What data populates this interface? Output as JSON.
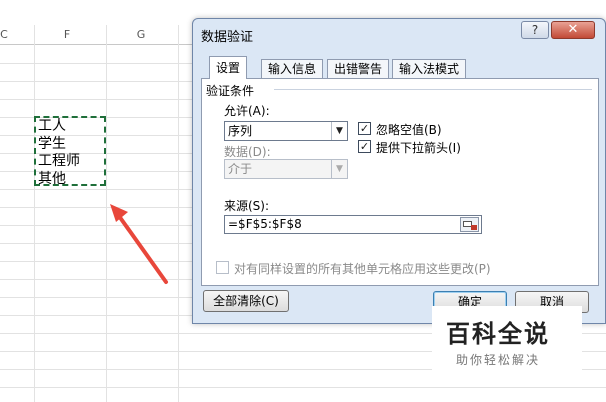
{
  "spreadsheet": {
    "column_headers": [
      "C",
      "F",
      "G"
    ],
    "list_values": [
      "工人",
      "学生",
      "工程师",
      "其他"
    ],
    "range_border_color": "#1f6f3a",
    "arrow_color": "#e8473b"
  },
  "dialog": {
    "title": "数据验证",
    "help_glyph": "?",
    "close_glyph": "✕",
    "tabs": [
      {
        "label": "设置",
        "active": true
      },
      {
        "label": "输入信息",
        "active": false
      },
      {
        "label": "出错警告",
        "active": false
      },
      {
        "label": "输入法模式",
        "active": false
      }
    ],
    "section_title": "验证条件",
    "allow": {
      "label": "允许(A):",
      "value": "序列"
    },
    "data": {
      "label": "数据(D):",
      "value": "介于"
    },
    "ignore_blank": {
      "label": "忽略空值(B)",
      "checked": true
    },
    "show_dropdown": {
      "label": "提供下拉箭头(I)",
      "checked": true
    },
    "source": {
      "label": "来源(S):",
      "value": "=$F$5:$F$8"
    },
    "apply_all": {
      "label": "对有同样设置的所有其他单元格应用这些更改(P)",
      "checked": false
    },
    "buttons": {
      "clear_all": "全部清除(C)",
      "ok": "确定",
      "cancel": "取消"
    }
  },
  "watermark": {
    "brand": "百科全说",
    "slogan": "助你轻松解决"
  }
}
